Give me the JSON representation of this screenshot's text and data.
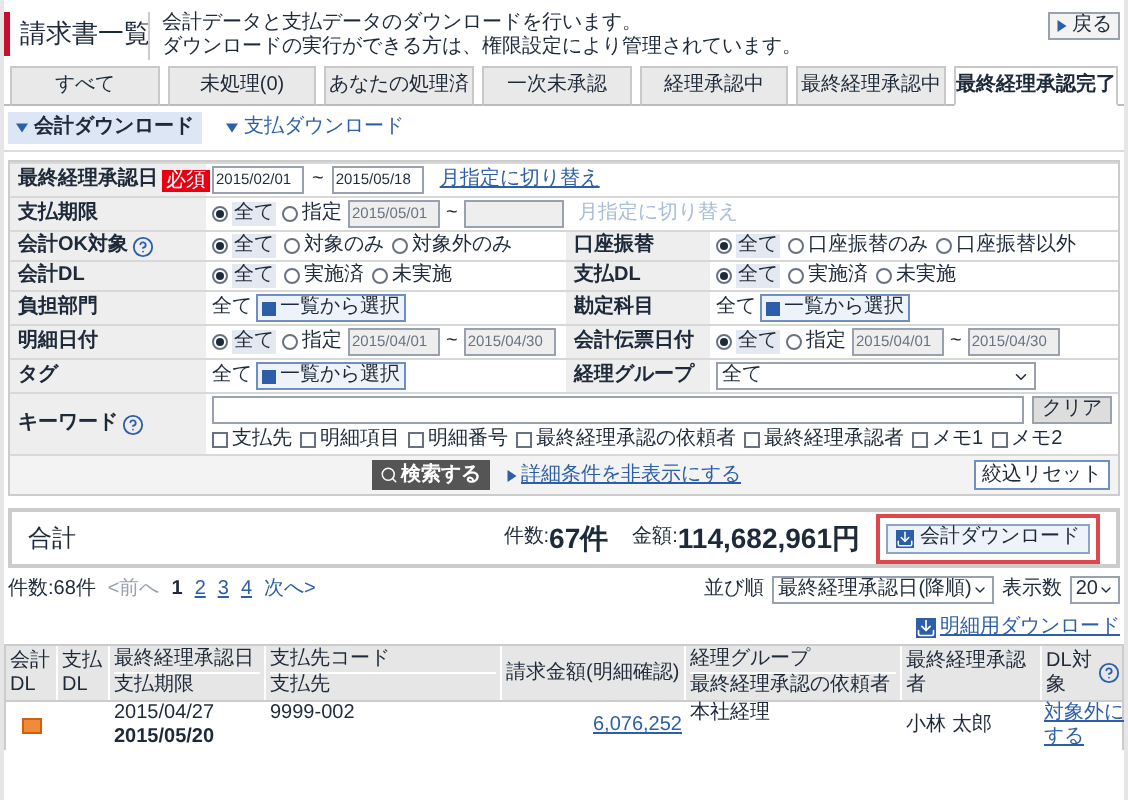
{
  "header": {
    "title": "請求書一覧",
    "description": [
      "会計データと支払データのダウンロードを行います。",
      "ダウンロードの実行ができる方は、権限設定により管理されています。"
    ],
    "back_button": "戻る"
  },
  "tabs": [
    {
      "label": "すべて",
      "selected": false
    },
    {
      "label": "未処理(0)",
      "selected": false
    },
    {
      "label": "あなたの処理済",
      "selected": false
    },
    {
      "label": "一次未承認",
      "selected": false
    },
    {
      "label": "経理承認中",
      "selected": false
    },
    {
      "label": "最終経理承認中",
      "selected": false
    },
    {
      "label": "最終経理承認完了",
      "selected": true
    }
  ],
  "subtabs": [
    {
      "label": "会計ダウンロード",
      "selected": true
    },
    {
      "label": "支払ダウンロード",
      "selected": false
    }
  ],
  "form": {
    "rows": [
      [
        {
          "label": "最終経理承認日",
          "required": "必須",
          "kind": "date_range",
          "from": "2015/02/01",
          "separator": "~",
          "to": "2015/05/18",
          "link": "月指定に切り替え"
        }
      ],
      [
        {
          "label": "支払期限",
          "kind": "radio_range",
          "options": [
            {
              "label": "全て",
              "selected": true
            },
            {
              "label": "指定",
              "selected": false
            }
          ],
          "from": "2015/05/01",
          "separator": "~",
          "link": "月指定に切り替え",
          "disabled": true
        }
      ],
      [
        {
          "label": "会計OK対象",
          "help": true,
          "kind": "radio",
          "options": [
            {
              "label": "全て",
              "selected": true
            },
            {
              "label": "対象のみ",
              "selected": false
            },
            {
              "label": "対象外のみ",
              "selected": false
            }
          ]
        },
        {
          "label": "口座振替",
          "kind": "radio",
          "options": [
            {
              "label": "全て",
              "selected": true
            },
            {
              "label": "口座振替のみ",
              "selected": false
            },
            {
              "label": "口座振替以外",
              "selected": false
            }
          ]
        }
      ],
      [
        {
          "label": "会計DL",
          "kind": "radio",
          "options": [
            {
              "label": "全て",
              "selected": true
            },
            {
              "label": "実施済",
              "selected": false
            },
            {
              "label": "未実施",
              "selected": false
            }
          ]
        },
        {
          "label": "支払DL",
          "kind": "radio",
          "options": [
            {
              "label": "全て",
              "selected": true
            },
            {
              "label": "実施済",
              "selected": false
            },
            {
              "label": "未実施",
              "selected": false
            }
          ]
        }
      ],
      [
        {
          "label": "負担部門",
          "kind": "picker",
          "value": "全て",
          "button": "一覧から選択"
        },
        {
          "label": "勘定科目",
          "kind": "picker",
          "value": "全て",
          "button": "一覧から選択"
        }
      ],
      [
        {
          "label": "明細日付",
          "kind": "radio_range",
          "options": [
            {
              "label": "全て",
              "selected": true
            },
            {
              "label": "指定",
              "selected": false
            }
          ],
          "from": "2015/04/01",
          "separator": "~",
          "to": "2015/04/30",
          "disabled": true
        },
        {
          "label": "会計伝票日付",
          "kind": "radio_range",
          "options": [
            {
              "label": "全て",
              "selected": true
            },
            {
              "label": "指定",
              "selected": false
            }
          ],
          "from": "2015/04/01",
          "separator": "~",
          "to": "2015/04/30",
          "disabled": true
        }
      ],
      [
        {
          "label": "タグ",
          "kind": "picker",
          "value": "全て",
          "button": "一覧から選択"
        },
        {
          "label": "経理グループ",
          "kind": "select",
          "value": "全て"
        }
      ],
      [
        {
          "label": "キーワード",
          "help": true,
          "kind": "keyword",
          "clear_button": "クリア",
          "checkboxes": [
            {
              "label": "支払先",
              "checked": false
            },
            {
              "label": "明細項目",
              "checked": false
            },
            {
              "label": "明細番号",
              "checked": false
            },
            {
              "label": "最終経理承認の依頼者",
              "checked": false
            },
            {
              "label": "最終経理承認者",
              "checked": false
            },
            {
              "label": "メモ1",
              "checked": false
            },
            {
              "label": "メモ2",
              "checked": false
            }
          ]
        }
      ]
    ],
    "search_button": "検索する",
    "toggle_link": "詳細条件を非表示にする",
    "reset_button": "絞込リセット"
  },
  "summary": {
    "label": "合計",
    "count_label": "件数:",
    "count": "67件",
    "amount_label": "金額:",
    "amount": "114,682,961円",
    "download_button": "会計ダウンロード"
  },
  "pagination": {
    "total": "件数:68件",
    "prev": "<前へ",
    "pages": [
      {
        "label": "1",
        "selected": true
      },
      {
        "label": "2",
        "selected": false
      },
      {
        "label": "3",
        "selected": false
      },
      {
        "label": "4",
        "selected": false
      }
    ],
    "next": "次へ>",
    "sort_label": "並び順",
    "sort_value": "最終経理承認日(降順)",
    "per_page_label": "表示数",
    "per_page": "20"
  },
  "detail_download": "明細用ダウンロード",
  "table": {
    "columns": [
      {
        "top": "会計DL"
      },
      {
        "top": "支払DL"
      },
      {
        "top": "最終経理承認日",
        "bottom": "支払期限"
      },
      {
        "top": "支払先コード",
        "bottom": "支払先"
      },
      {
        "top": "請求金額(明細確認)"
      },
      {
        "top": "経理グループ",
        "bottom": "最終経理承認の依頼者"
      },
      {
        "top": "最終経理承認者"
      },
      {
        "top": "DL対象",
        "help": true
      }
    ],
    "rows": [
      {
        "accounting_dl": true,
        "approved": "2015/04/27",
        "due": "2015/05/20",
        "code": "9999-002",
        "amount": "6,076,252",
        "group": "本社経理",
        "approver": "小林 太郎",
        "action": "対象外にする"
      }
    ]
  }
}
